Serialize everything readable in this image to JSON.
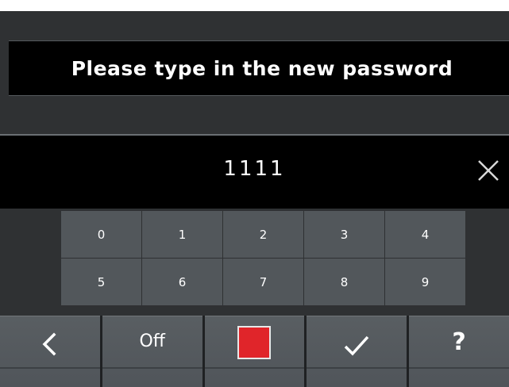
{
  "dialog": {
    "prompt": "Please type in the new password"
  },
  "entry": {
    "value": "1111",
    "clear_icon": "close-icon"
  },
  "keypad": {
    "keys": [
      "0",
      "1",
      "2",
      "3",
      "4",
      "5",
      "6",
      "7",
      "8",
      "9"
    ]
  },
  "toolbar": {
    "back_icon": "chevron-left-icon",
    "off_label": "Off",
    "stop_icon": "stop-square-icon",
    "confirm_icon": "checkmark-icon",
    "help_label": "?"
  },
  "colors": {
    "panel_background": "#2f3133",
    "bar_background": "#000000",
    "key_background": "#52575b",
    "stop_red": "#e0252a",
    "text": "#ffffff"
  }
}
